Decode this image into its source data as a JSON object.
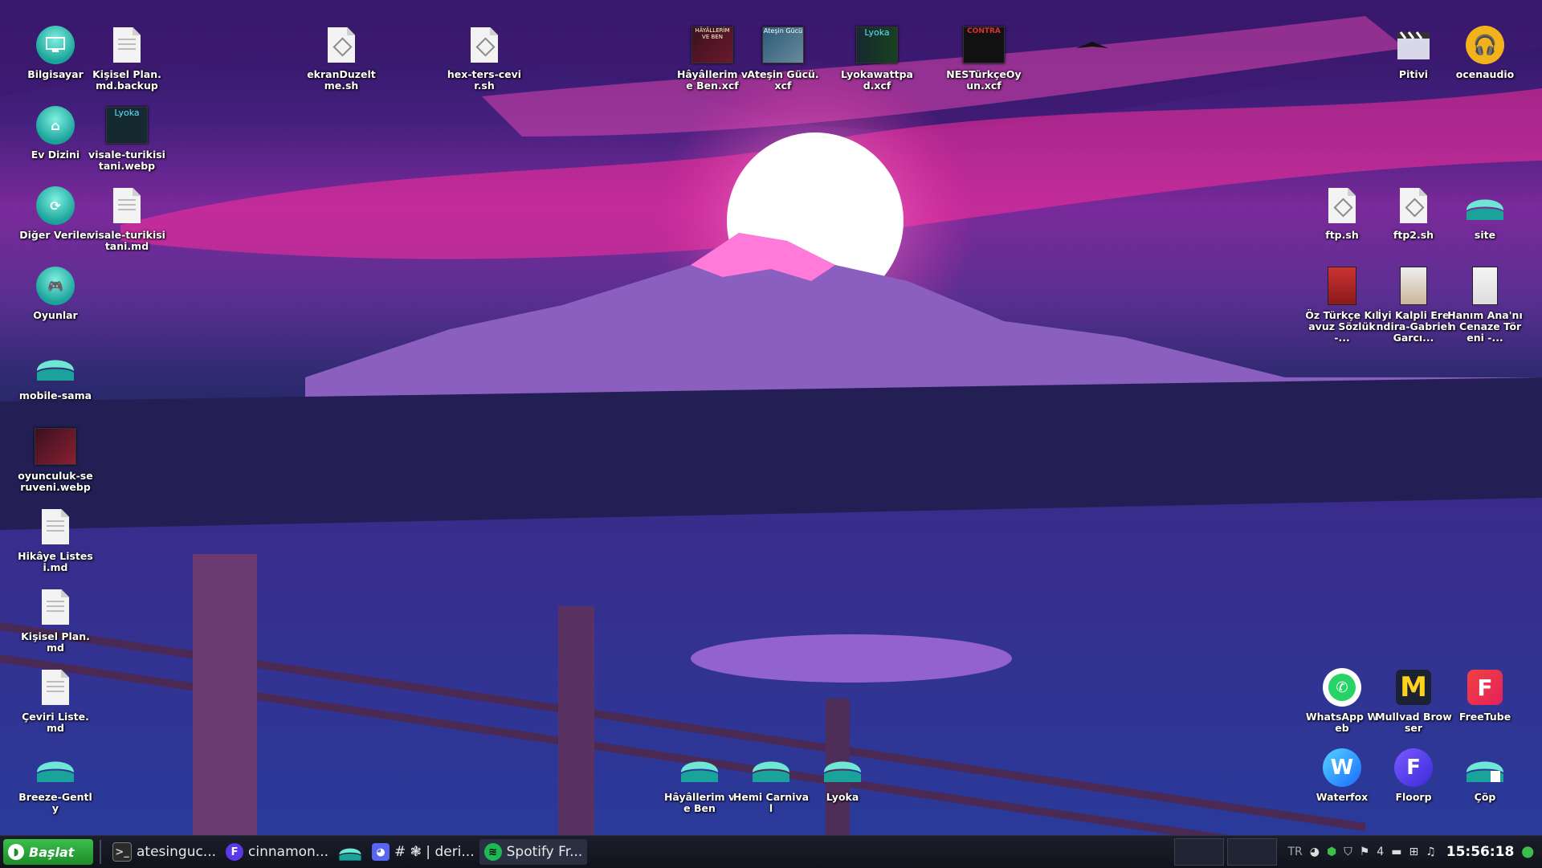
{
  "desktop": {
    "left_col": [
      {
        "label": "Bilgisayar",
        "icon": "computer-icon"
      },
      {
        "label": "Ev Dizini",
        "icon": "home-folder-icon"
      },
      {
        "label": "Diğer Veriler",
        "icon": "data-folder-icon"
      },
      {
        "label": "Oyunlar",
        "icon": "games-folder-icon"
      },
      {
        "label": "mobile-sama",
        "icon": "breeze-folder-icon"
      },
      {
        "label": "oyunculuk-seruveni.webp",
        "icon": "image-thumbnail-icon"
      },
      {
        "label": "Hikâye Listesi.md",
        "icon": "document-icon"
      },
      {
        "label": "Kişisel Plan.md",
        "icon": "document-icon"
      },
      {
        "label": "Çeviri Liste.md",
        "icon": "document-icon"
      },
      {
        "label": "Breeze-Gently",
        "icon": "breeze-folder-icon"
      }
    ],
    "second_col": [
      {
        "label": "Kişisel Plan.md.backup",
        "icon": "document-icon"
      },
      {
        "label": "visale-turikisitani.webp",
        "icon": "image-thumbnail-icon",
        "thumb_text": "Lyoka"
      },
      {
        "label": "visale-turikisitani.md",
        "icon": "document-icon"
      }
    ],
    "top_row": [
      {
        "label": "ekranDuzeltme.sh",
        "icon": "script-icon"
      },
      {
        "label": "hex-ters-cevir.sh",
        "icon": "script-icon"
      },
      {
        "label": "Hâyâllerim ve Ben.xcf",
        "icon": "image-thumbnail-icon",
        "thumb_text": "HÂYÂLLERİM VE BEN"
      },
      {
        "label": "Ateşin Gücü.xcf",
        "icon": "image-thumbnail-icon",
        "thumb_text": "Ateşin Gücü"
      },
      {
        "label": "Lyokawattpad.xcf",
        "icon": "image-thumbnail-icon",
        "thumb_text": "Lyoka"
      },
      {
        "label": "NESTürkçeOyun.xcf",
        "icon": "image-thumbnail-icon",
        "thumb_text": "CONTRA"
      }
    ],
    "right_icons": [
      {
        "label": "Pitivi",
        "icon": "clapperboard-icon"
      },
      {
        "label": "ocenaudio",
        "icon": "headphones-icon"
      },
      {
        "label": "ftp.sh",
        "icon": "script-icon"
      },
      {
        "label": "ftp2.sh",
        "icon": "script-icon"
      },
      {
        "label": "site",
        "icon": "breeze-folder-icon"
      },
      {
        "label": "Öz Türkçe Kılavuz Sözlük-...",
        "icon": "book-thumbnail-icon"
      },
      {
        "label": "İyi Kalpli Erendira-Gabriel Garcı...",
        "icon": "book-thumbnail-icon"
      },
      {
        "label": "Hanım Ana'nın Cenaze Töreni -...",
        "icon": "book-thumbnail-icon"
      },
      {
        "label": "WhatsApp Web",
        "icon": "whatsapp-icon"
      },
      {
        "label": "Mullvad Browser",
        "icon": "mullvad-icon"
      },
      {
        "label": "FreeTube",
        "icon": "freetube-icon"
      },
      {
        "label": "Waterfox",
        "icon": "waterfox-icon"
      },
      {
        "label": "Floorp",
        "icon": "floorp-icon"
      },
      {
        "label": "Çöp",
        "icon": "trash-icon"
      }
    ],
    "bottom_row": [
      {
        "label": "Hâyâllerim ve Ben",
        "icon": "breeze-folder-icon"
      },
      {
        "label": "Hemi Carnival",
        "icon": "breeze-folder-icon"
      },
      {
        "label": "Lyoka",
        "icon": "breeze-folder-icon"
      }
    ]
  },
  "taskbar": {
    "start_label": "Başlat",
    "tasks": [
      {
        "label": "atesinguc...",
        "icon": "terminal-icon"
      },
      {
        "label": "cinnamon...",
        "icon": "floorp-icon"
      },
      {
        "label": "",
        "icon": "breeze-folder-icon"
      },
      {
        "label": "# ❃ | deri...",
        "icon": "discord-icon"
      },
      {
        "label": "Spotify Fr...",
        "icon": "spotify-icon"
      }
    ],
    "keyboard_layout": "TR",
    "tray_badge": "4",
    "clock": "15:56:18"
  },
  "colors": {
    "accent": "#ff3fb0",
    "start_green": "#2aa63a",
    "sun": "#ffffff",
    "sky_pink": "#ff2d9a"
  }
}
